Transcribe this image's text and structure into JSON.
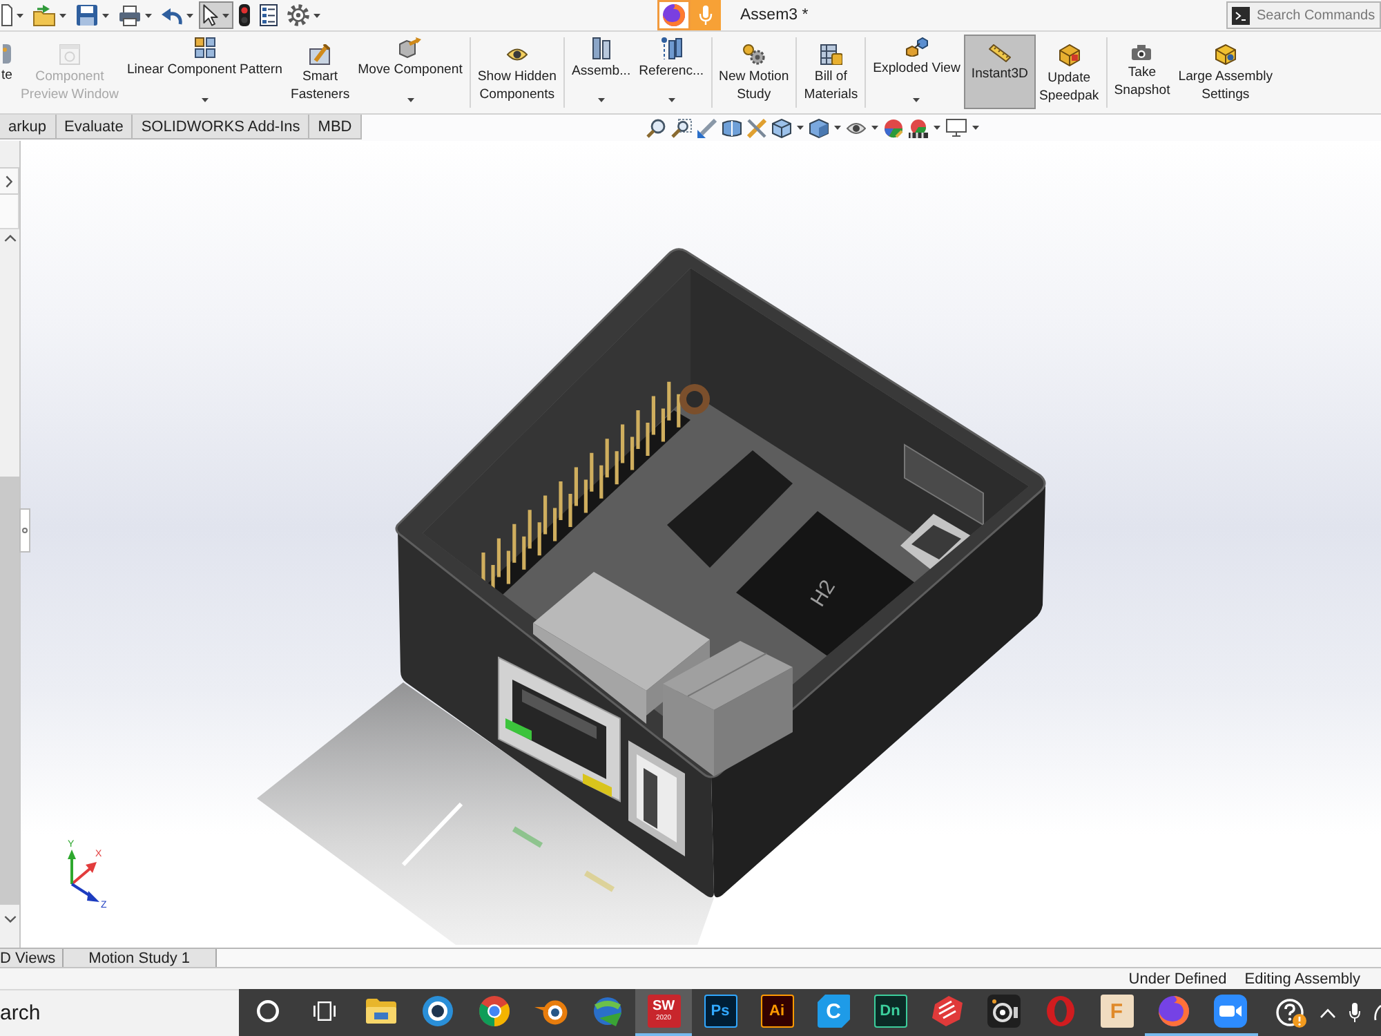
{
  "window": {
    "title": "Assem3 *"
  },
  "quick_access": [
    {
      "menu": true,
      "selected": false
    },
    {
      "menu": true,
      "selected": false
    },
    {
      "menu": true,
      "selected": false
    },
    {
      "menu": true,
      "selected": false
    },
    {
      "menu": true,
      "selected": false
    },
    {
      "menu": true,
      "selected": true
    },
    {
      "menu": false,
      "selected": false
    },
    {
      "menu": false,
      "selected": false
    },
    {
      "menu": true,
      "selected": false
    }
  ],
  "search": {
    "placeholder": "Search Commands"
  },
  "ribbon": {
    "groups": [
      [
        {
          "label": "te",
          "menu": false,
          "disabled": false,
          "selected": false
        },
        {
          "label": "Component Preview Window",
          "menu": false,
          "disabled": true,
          "selected": false
        },
        {
          "label": "Linear Component Pattern",
          "menu": true,
          "disabled": false,
          "selected": false
        },
        {
          "label": "Smart Fasteners",
          "menu": false,
          "disabled": false,
          "selected": false
        },
        {
          "label": "Move Component",
          "menu": true,
          "disabled": false,
          "selected": false
        }
      ],
      [
        {
          "label": "Show Hidden Components",
          "menu": false,
          "disabled": false,
          "selected": false
        }
      ],
      [
        {
          "label": "Assemb...",
          "menu": true,
          "disabled": false,
          "selected": false
        },
        {
          "label": "Referenc...",
          "menu": true,
          "disabled": false,
          "selected": false
        }
      ],
      [
        {
          "label": "New Motion Study",
          "menu": false,
          "disabled": false,
          "selected": false
        }
      ],
      [
        {
          "label": "Bill of Materials",
          "menu": false,
          "disabled": false,
          "selected": false
        }
      ],
      [
        {
          "label": "Exploded View",
          "menu": true,
          "disabled": false,
          "selected": false
        },
        {
          "label": "Instant3D",
          "menu": false,
          "disabled": false,
          "selected": true
        },
        {
          "label": "Update Speedpak",
          "menu": false,
          "disabled": false,
          "selected": false
        }
      ],
      [
        {
          "label": "Take Snapshot",
          "menu": false,
          "disabled": false,
          "selected": false
        },
        {
          "label": "Large Assembly Settings",
          "menu": false,
          "disabled": false,
          "selected": false
        }
      ]
    ]
  },
  "tabs": [
    {
      "label": "arkup",
      "selected": false
    },
    {
      "label": "Evaluate",
      "selected": false
    },
    {
      "label": "SOLIDWORKS Add-Ins",
      "selected": false
    },
    {
      "label": "MBD",
      "selected": false
    }
  ],
  "view_toolbar": [
    {
      "menu": false
    },
    {
      "menu": false
    },
    {
      "menu": false
    },
    {
      "menu": false
    },
    {
      "menu": false
    },
    {
      "menu": true
    },
    {
      "menu": true
    },
    {
      "menu": true
    },
    {
      "menu": false
    },
    {
      "menu": true
    },
    {
      "menu": true
    }
  ],
  "viewport": {
    "chip_label": "H2",
    "triad": [
      {
        "label": "X",
        "color": "#e23c3c"
      },
      {
        "label": "Y",
        "color": "#2ea82e"
      },
      {
        "label": "Z",
        "color": "#1c3cc0"
      }
    ]
  },
  "bottom_tabs": [
    {
      "label": "D Views",
      "selected": false
    },
    {
      "label": "Motion Study 1",
      "selected": false
    }
  ],
  "status_bar": [
    "Under Defined",
    "Editing Assembly"
  ],
  "taskbar": {
    "search": {
      "placeholder": "arch"
    },
    "apps": [
      {
        "running": false,
        "selected": false
      },
      {
        "running": false,
        "selected": false
      },
      {
        "running": false,
        "selected": false
      },
      {
        "running": false,
        "selected": false
      },
      {
        "running": false,
        "selected": false
      },
      {
        "running": false,
        "selected": false
      },
      {
        "running": false,
        "selected": false
      },
      {
        "logo": "SW",
        "logo_sub": "2020",
        "running": true,
        "selected": true
      },
      {
        "logo": "Ps",
        "running": false,
        "selected": false
      },
      {
        "logo": "Ai",
        "running": false,
        "selected": false
      },
      {
        "logo": "C",
        "running": false,
        "selected": false
      },
      {
        "logo": "Dn",
        "running": false,
        "selected": false
      },
      {
        "running": false,
        "selected": false
      },
      {
        "running": false,
        "selected": false
      },
      {
        "running": false,
        "selected": false
      },
      {
        "logo": "F",
        "running": false,
        "selected": false
      },
      {
        "running": true,
        "selected": false
      },
      {
        "running": true,
        "selected": false
      }
    ]
  }
}
